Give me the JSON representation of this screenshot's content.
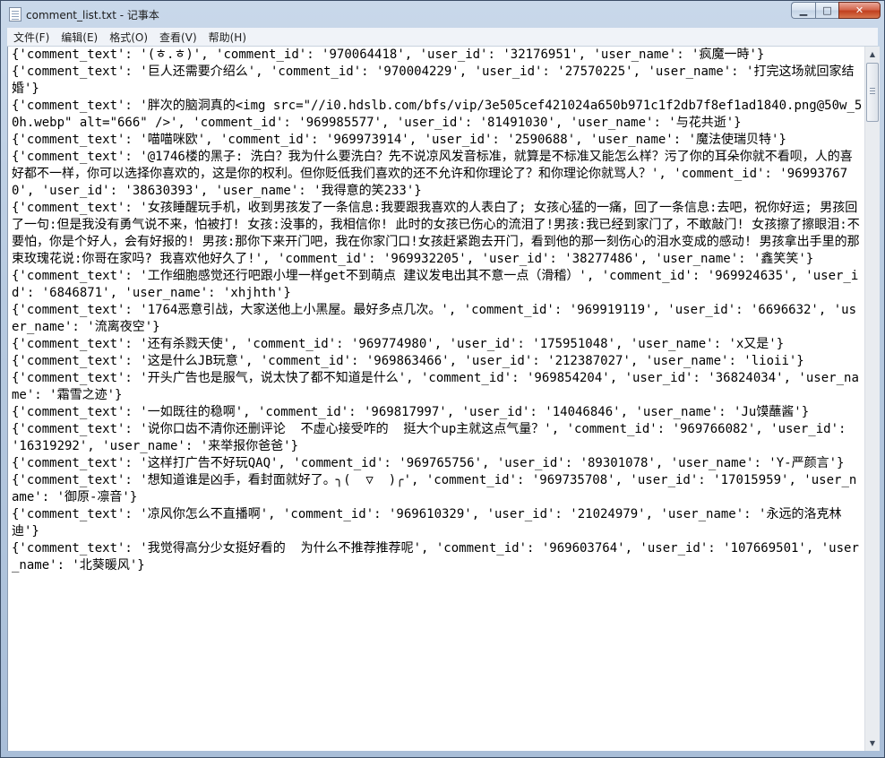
{
  "window": {
    "title": "comment_list.txt - 记事本"
  },
  "caption": {
    "minimize": "▁",
    "maximize": "□",
    "close": "✕"
  },
  "menu": [
    {
      "label": "文件(F)"
    },
    {
      "label": "编辑(E)"
    },
    {
      "label": "格式(O)"
    },
    {
      "label": "查看(V)"
    },
    {
      "label": "帮助(H)"
    }
  ],
  "editor": {
    "content": "{'comment_text': '(ㅎ.ㅎ)', 'comment_id': '970064418', 'user_id': '32176951', 'user_name': '疯魔一時'}\n{'comment_text': '巨人还需要介绍么', 'comment_id': '970004229', 'user_id': '27570225', 'user_name': '打完这场就回家结婚'}\n{'comment_text': '胖次的脑洞真的<img src=\"//i0.hdslb.com/bfs/vip/3e505cef421024a650b971c1f2db7f8ef1ad1840.png@50w_50h.webp\" alt=\"666\" />', 'comment_id': '969985577', 'user_id': '81491030', 'user_name': '与花共逝'}\n{'comment_text': '喵喵咪欧', 'comment_id': '969973914', 'user_id': '2590688', 'user_name': '魔法使瑞贝特'}\n{'comment_text': '@1746楼的黑子: 洗白？我为什么要洗白？先不说凉风发音标准，就算是不标准又能怎么样？污了你的耳朵你就不看呗，人的喜好都不一样，你可以选择你喜欢的，这是你的权利。但你贬低我们喜欢的还不允许和你理论了？和你理论你就骂人？', 'comment_id': '969937670', 'user_id': '38630393', 'user_name': '我得意的笑233'}\n{'comment_text': '女孩睡醒玩手机，收到男孩发了一条信息:我要跟我喜欢的人表白了; 女孩心猛的一痛，回了一条信息:去吧，祝你好运; 男孩回了一句:但是我没有勇气说不来，怕被打! 女孩:没事的，我相信你! 此时的女孩已伤心的流泪了!男孩:我已经到家门了，不敢敲门! 女孩擦了擦眼泪:不要怕，你是个好人，会有好报的! 男孩:那你下来开门吧，我在你家门口!女孩赶紧跑去开门，看到他的那一刻伤心的泪水变成的感动! 男孩拿出手里的那束玫瑰花说:你哥在家吗? 我喜欢他好久了!', 'comment_id': '969932205', 'user_id': '38277486', 'user_name': '鑫笑笑'}\n{'comment_text': '工作细胞感觉还行吧跟小埋一样get不到萌点 建议发电出其不意一点（滑稽）', 'comment_id': '969924635', 'user_id': '6846871', 'user_name': 'xhjhth'}\n{'comment_text': '1764恶意引战，大家送他上小黑屋。最好多点几次。', 'comment_id': '969919119', 'user_id': '6696632', 'user_name': '流离夜空'}\n{'comment_text': '还有杀戮天使', 'comment_id': '969774980', 'user_id': '175951048', 'user_name': 'x又是'}\n{'comment_text': '这是什么JB玩意', 'comment_id': '969863466', 'user_id': '212387027', 'user_name': 'lioii'}\n{'comment_text': '开头广告也是服气，说太快了都不知道是什么', 'comment_id': '969854204', 'user_id': '36824034', 'user_name': '霜雪之迹'}\n{'comment_text': '一如既往的稳啊', 'comment_id': '969817997', 'user_id': '14046846', 'user_name': 'Ju馍蘸酱'}\n{'comment_text': '说你口齿不清你还删评论  不虚心接受咋的  挺大个up主就这点气量？', 'comment_id': '969766082', 'user_id': '16319292', 'user_name': '来举报你爸爸'}\n{'comment_text': '这样打广告不好玩QAQ', 'comment_id': '969765756', 'user_id': '89301078', 'user_name': 'Y-严颜言'}\n{'comment_text': '想知道谁是凶手，看封面就好了。╮(  ▽  )╭', 'comment_id': '969735708', 'user_id': '17015959', 'user_name': '御原-凛音'}\n{'comment_text': '凉风你怎么不直播啊', 'comment_id': '969610329', 'user_id': '21024979', 'user_name': '永远的洛克林迪'}\n{'comment_text': '我觉得高分少女挺好看的  为什么不推荐推荐呢', 'comment_id': '969603764', 'user_id': '107669501', 'user_name': '北葵暖风'}"
  },
  "scrollbar": {
    "up_arrow": "▲",
    "down_arrow": "▼"
  }
}
